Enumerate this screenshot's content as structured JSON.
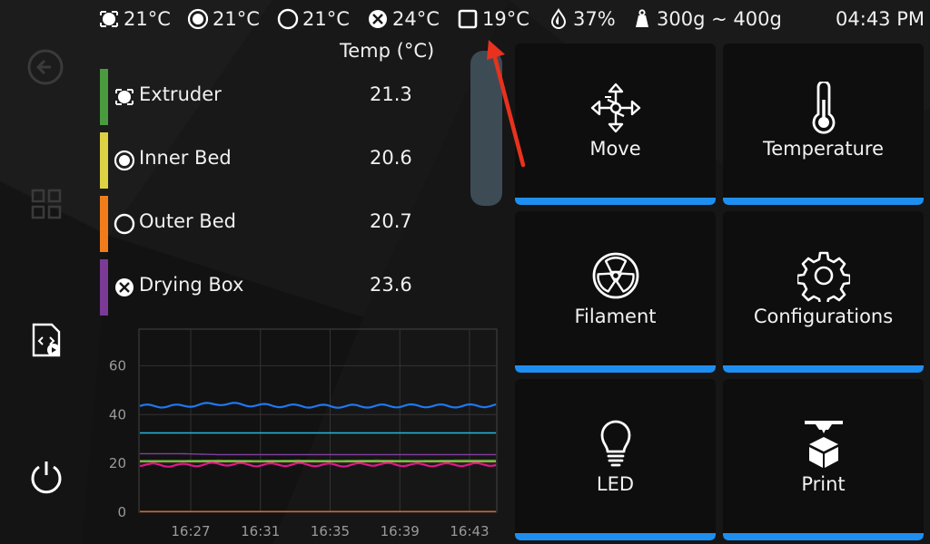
{
  "status_bar": {
    "extruder_temp": "21°C",
    "inner_bed_temp": "21°C",
    "outer_bed_temp": "21°C",
    "drying_box_temp": "24°C",
    "chamber_temp": "19°C",
    "humidity": "37%",
    "filament_weight": "300g ~ 400g",
    "time": "04:43 PM"
  },
  "temp_list": {
    "header": "Temp (°C)",
    "rows": [
      {
        "name": "Extruder",
        "value": "21.3",
        "color": "#4a9a3e"
      },
      {
        "name": "Inner Bed",
        "value": "20.6",
        "color": "#dcd244"
      },
      {
        "name": "Outer Bed",
        "value": "20.7",
        "color": "#f07d1a"
      },
      {
        "name": "Drying Box",
        "value": "23.6",
        "color": "#7a3a96"
      }
    ]
  },
  "chart_data": {
    "type": "line",
    "x_ticks": [
      "16:27",
      "16:31",
      "16:35",
      "16:39",
      "16:43"
    ],
    "y_ticks": [
      "0",
      "20",
      "40",
      "60"
    ],
    "ylim": [
      0,
      75
    ],
    "series": [
      {
        "color": "#1e78f0",
        "values": [
          43.5,
          43.5,
          44.5,
          43.8,
          43.5,
          43.4,
          43.5,
          43.6,
          43.5,
          43.7
        ]
      },
      {
        "color": "#27b8e0",
        "values": [
          32.5,
          32.5,
          32.5,
          32.5,
          32.5,
          32.5,
          32.5,
          32.5,
          32.5,
          32.5
        ]
      },
      {
        "color": "#8040a0",
        "values": [
          24,
          24,
          23.6,
          23.6,
          23.6,
          23.6,
          23.6,
          23.6,
          23.6,
          23.6
        ]
      },
      {
        "color": "#dcd244",
        "values": [
          20.8,
          20.8,
          20.8,
          20.8,
          20.8,
          20.8,
          20.8,
          20.8,
          20.8,
          20.8
        ]
      },
      {
        "color": "#4a9a3e",
        "values": [
          21.2,
          21.2,
          21.3,
          21.2,
          21.3,
          21.2,
          21.3,
          21.2,
          21.3,
          21.3
        ]
      },
      {
        "color": "#e01890",
        "values": [
          19.5,
          19.2,
          19.8,
          19.4,
          19.6,
          19.3,
          19.7,
          19.4,
          19.5,
          19.6
        ]
      },
      {
        "color": "#e07030",
        "values": [
          0.3,
          0.3,
          0.3,
          0.3,
          0.3,
          0.3,
          0.3,
          0.3,
          0.3,
          0.3
        ]
      }
    ]
  },
  "tiles": [
    {
      "label": "Move",
      "icon": "move-arrows-icon"
    },
    {
      "label": "Temperature",
      "icon": "thermometer-icon"
    },
    {
      "label": "Filament",
      "icon": "filament-spool-icon"
    },
    {
      "label": "Configurations",
      "icon": "gear-icon"
    },
    {
      "label": "LED",
      "icon": "lightbulb-icon"
    },
    {
      "label": "Print",
      "icon": "print-nozzle-icon"
    }
  ],
  "colors": {
    "accent": "#1e8ff0",
    "arrow": "#e8321e"
  }
}
